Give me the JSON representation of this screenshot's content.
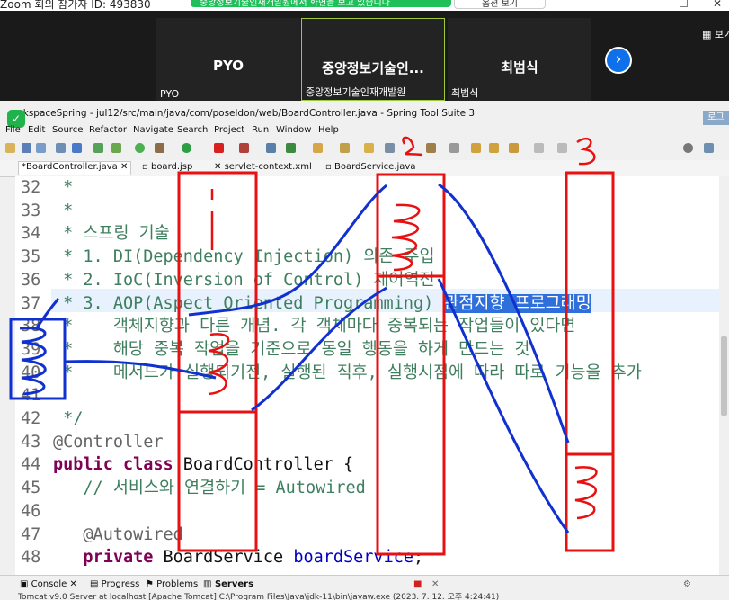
{
  "zoom": {
    "title": "Zoom 회의 참가자 ID: 493830",
    "banner_text": "중앙정보기술인재개발원에서 화면을 보고 있습니다",
    "banner_button": "옵션 보기",
    "view_label": "보기",
    "participants": [
      {
        "name": "PYO",
        "sub": "PYO"
      },
      {
        "name": "중앙정보기술인...",
        "sub": "중앙정보기술인재개발원"
      },
      {
        "name": "최범식",
        "sub": "최범식"
      }
    ],
    "next_glyph": "›"
  },
  "eclipse": {
    "title": "orkspaceSpring - jul12/src/main/java/com/poseldon/web/BoardController.java - Spring Tool Suite 3",
    "lock_label": "로그",
    "menu": [
      "File",
      "Edit",
      "Source",
      "Refactor",
      "Navigate",
      "Search",
      "Project",
      "Run",
      "Window",
      "Help"
    ],
    "tabs": [
      "*BoardController.java",
      "board.jsp",
      "servlet-context.xml",
      "BoardService.java"
    ],
    "bottom_tabs": [
      "Console",
      "Progress",
      "Problems",
      "Servers"
    ],
    "status": "Tomcat v9.0 Server at localhost [Apache Tomcat] C:\\Program Files\\Java\\jdk-11\\bin\\javaw.exe  (2023. 7. 12. 오후 4:24:41)"
  },
  "code": {
    "lines": [
      {
        "n": "32",
        "parts": [
          {
            "t": " *",
            "c": "cm"
          }
        ]
      },
      {
        "n": "33",
        "parts": [
          {
            "t": " *",
            "c": "cm"
          }
        ]
      },
      {
        "n": "34",
        "parts": [
          {
            "t": " * 스프링 기술",
            "c": "cm"
          }
        ]
      },
      {
        "n": "35",
        "parts": [
          {
            "t": " * 1. DI(Dependency Injection) 의존 주입",
            "c": "cm"
          }
        ]
      },
      {
        "n": "36",
        "parts": [
          {
            "t": " * 2. IoC(Inversion of Control) 제어역전",
            "c": "cm"
          }
        ]
      },
      {
        "n": "37",
        "parts": [
          {
            "t": " * 3. AOP(Aspect Oriented Programming) ",
            "c": "cm"
          },
          {
            "t": "관점지향 프로그래밍",
            "c": "sel"
          }
        ]
      },
      {
        "n": "38",
        "parts": [
          {
            "t": " *    객체지향과 다른 개념. 각 객체마다 중복되는 작업들이 있다면",
            "c": "cm"
          }
        ]
      },
      {
        "n": "39",
        "parts": [
          {
            "t": " *    해당 중복 작업을 기준으로 동일 행동을 하게 만드는 것.",
            "c": "cm"
          }
        ]
      },
      {
        "n": "40",
        "parts": [
          {
            "t": " *    메서드가 실행되기전, 실행된 직후, 실행시점에 따라 따로 기능을 추가",
            "c": "cm"
          }
        ]
      },
      {
        "n": "41",
        "parts": [
          {
            "t": "",
            "c": "cm"
          }
        ]
      },
      {
        "n": "42",
        "parts": [
          {
            "t": " */",
            "c": "cm"
          }
        ]
      },
      {
        "n": "43",
        "parts": [
          {
            "t": "@Controller",
            "c": "an"
          }
        ]
      },
      {
        "n": "44",
        "parts": [
          {
            "t": "public class ",
            "c": "kw"
          },
          {
            "t": "BoardController {",
            "c": "plain"
          }
        ]
      },
      {
        "n": "45",
        "parts": [
          {
            "t": "   // 서비스와 연결하기 = Autowired",
            "c": "cm"
          }
        ]
      },
      {
        "n": "46",
        "parts": [
          {
            "t": "",
            "c": "plain"
          }
        ]
      },
      {
        "n": "47",
        "parts": [
          {
            "t": "   @Autowired",
            "c": "an"
          }
        ]
      },
      {
        "n": "48",
        "parts": [
          {
            "t": "   private ",
            "c": "kw"
          },
          {
            "t": "BoardService ",
            "c": "plain"
          },
          {
            "t": "boardService",
            "c": "fld"
          },
          {
            "t": ";",
            "c": "plain"
          }
        ]
      }
    ]
  },
  "annotations": {
    "labels": [
      "1",
      "2",
      "3"
    ],
    "color": "#e81010",
    "blue": "#1030d0"
  }
}
